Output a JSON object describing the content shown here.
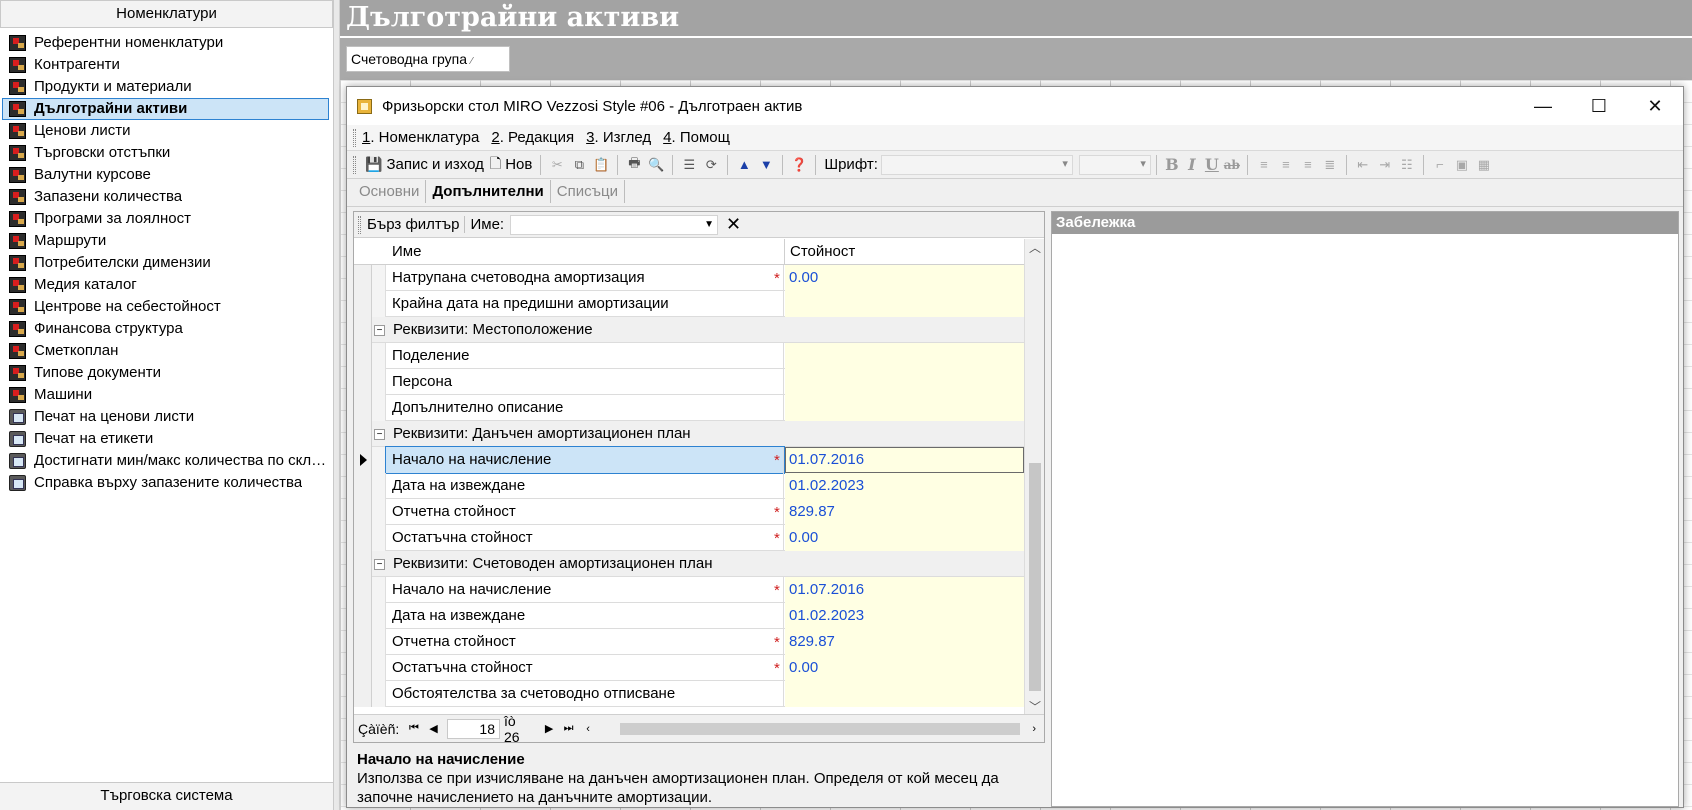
{
  "left_panel": {
    "header": "Номенклатури",
    "footer": "Търговска система",
    "items": [
      {
        "label": "Референтни номенклатури",
        "icon": "book-icon"
      },
      {
        "label": "Контрагенти",
        "icon": "book-icon"
      },
      {
        "label": "Продукти и материали",
        "icon": "book-icon"
      },
      {
        "label": "Дълготрайни активи",
        "icon": "book-icon",
        "selected": true
      },
      {
        "label": "Ценови листи",
        "icon": "book-icon"
      },
      {
        "label": "Търговски отстъпки",
        "icon": "book-icon"
      },
      {
        "label": "Валутни курсове",
        "icon": "book-icon"
      },
      {
        "label": "Запазени количества",
        "icon": "book-icon"
      },
      {
        "label": "Програми за лоялност",
        "icon": "book-icon"
      },
      {
        "label": "Маршрути",
        "icon": "book-icon"
      },
      {
        "label": "Потребителски димензии",
        "icon": "book-icon"
      },
      {
        "label": "Медия каталог",
        "icon": "book-icon"
      },
      {
        "label": "Центрове на себестойност",
        "icon": "book-icon"
      },
      {
        "label": "Финансова структура",
        "icon": "book-icon"
      },
      {
        "label": "Сметкоплан",
        "icon": "book-icon"
      },
      {
        "label": "Типове документи",
        "icon": "book-icon"
      },
      {
        "label": "Машини",
        "icon": "book-icon"
      },
      {
        "label": "Печат на ценови листи",
        "icon": "print-icon"
      },
      {
        "label": "Печат на етикети",
        "icon": "print-icon"
      },
      {
        "label": "Достигнати мин/макс количества по скла...",
        "icon": "print-icon"
      },
      {
        "label": "Справка върху запазените количества",
        "icon": "print-icon"
      }
    ]
  },
  "main": {
    "title": "Дълготрайни активи",
    "group_by_label": "Счетоводна група"
  },
  "dialog": {
    "title": "Фризьорски стол MIRO Vezzosi Style #06 - Дълготраен актив",
    "menu": [
      {
        "key": "1",
        "label": ". Номенклатура"
      },
      {
        "key": "2",
        "label": ". Редакция"
      },
      {
        "key": "3",
        "label": ". Изглед"
      },
      {
        "key": "4",
        "label": ". Помощ"
      }
    ],
    "toolbar": {
      "save_close": "Запис и изход",
      "new": "Нов",
      "font_label": "Шрифт:"
    },
    "tabs": [
      {
        "label": "Основни",
        "active": false
      },
      {
        "label": "Допълнителни",
        "active": true
      },
      {
        "label": "Списъци",
        "active": false
      }
    ],
    "filter": {
      "quick_filter": "Бърз филтър",
      "name_label": "Име:",
      "name_value": ""
    },
    "grid": {
      "col_name": "Име",
      "col_value": "Стойност",
      "rows": [
        {
          "type": "field",
          "name": "Натрупана счетоводна амортизация",
          "required": true,
          "value": "0.00"
        },
        {
          "type": "field",
          "name": "Крайна дата на предишни амортизации",
          "required": false,
          "value": ""
        },
        {
          "type": "group",
          "name": "Реквизити: Местоположение"
        },
        {
          "type": "field",
          "name": "Поделение",
          "required": false,
          "value": ""
        },
        {
          "type": "field",
          "name": "Персона",
          "required": false,
          "value": ""
        },
        {
          "type": "field",
          "name": "Допълнително описание",
          "required": false,
          "value": ""
        },
        {
          "type": "group",
          "name": "Реквизити: Данъчен амортизационен план"
        },
        {
          "type": "field",
          "name": "Начало на начисление",
          "required": true,
          "value": "01.07.2016",
          "current": true
        },
        {
          "type": "field",
          "name": "Дата на извеждане",
          "required": false,
          "value": "01.02.2023"
        },
        {
          "type": "field",
          "name": "Отчетна стойност",
          "required": true,
          "value": "829.87"
        },
        {
          "type": "field",
          "name": "Остатъчна стойност",
          "required": true,
          "value": "0.00"
        },
        {
          "type": "group",
          "name": "Реквизити: Счетоводен амортизационен план"
        },
        {
          "type": "field",
          "name": "Начало на начисление",
          "required": true,
          "value": "01.07.2016"
        },
        {
          "type": "field",
          "name": "Дата на извеждане",
          "required": false,
          "value": "01.02.2023"
        },
        {
          "type": "field",
          "name": "Отчетна стойност",
          "required": true,
          "value": "829.87"
        },
        {
          "type": "field",
          "name": "Остатъчна стойност",
          "required": true,
          "value": "0.00"
        },
        {
          "type": "field",
          "name": "Обстоятелства за счетоводно отписване",
          "required": false,
          "value": ""
        }
      ]
    },
    "navigator": {
      "label": "Çàïèñ:",
      "current": "18",
      "of_label": "îò 26"
    },
    "description": {
      "title": "Начало на начисление",
      "text": "Използва се при изчисляване на данъчен амортизационен план. Определя от кой месец да започне начислението на данъчните амортизации."
    },
    "remark": {
      "title": "Забележка"
    }
  }
}
